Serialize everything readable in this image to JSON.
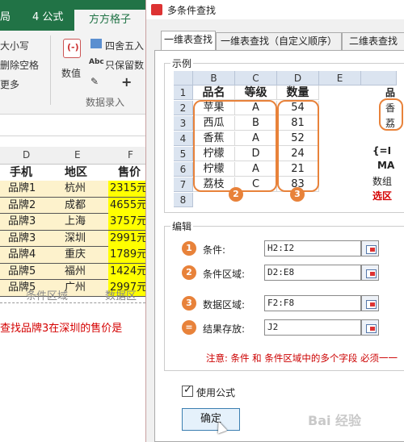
{
  "excel": {
    "tabs": [
      "局",
      "4 公式",
      "方方格子"
    ],
    "ribbon": {
      "left_items": [
        "大小写",
        "删除空格",
        "更多"
      ],
      "group_buttons": [
        "四舍五入",
        "只保留数",
        "数值"
      ],
      "group_label": "数据录入",
      "numeric_button": "数值"
    },
    "columns": [
      "D",
      "E",
      "F"
    ],
    "headers": [
      "手机",
      "地区",
      "售价"
    ],
    "rows": [
      {
        "phone": "品牌1",
        "region": "杭州",
        "price": "2315元"
      },
      {
        "phone": "品牌2",
        "region": "成都",
        "price": "4655元"
      },
      {
        "phone": "品牌3",
        "region": "上海",
        "price": "3757元"
      },
      {
        "phone": "品牌3",
        "region": "深圳",
        "price": "2991元"
      },
      {
        "phone": "品牌4",
        "region": "重庆",
        "price": "1789元"
      },
      {
        "phone": "品牌5",
        "region": "福州",
        "price": "1424元"
      },
      {
        "phone": "品牌5",
        "region": "广州",
        "price": "2997元"
      }
    ],
    "footer_labels": [
      "条件区域",
      "数据区"
    ],
    "red_note": "查找品牌3在深圳的售价是"
  },
  "dialog": {
    "title": "多条件查找",
    "tabs": [
      "一维表查找",
      "一维表查找（自定义顺序）",
      "二维表查找"
    ],
    "example_group": "示例",
    "example": {
      "col_headers": [
        "B",
        "C",
        "D",
        "E"
      ],
      "row_numbers": [
        "1",
        "2",
        "3",
        "4",
        "5",
        "6",
        "7",
        "8"
      ],
      "header_row": [
        "品名",
        "等级",
        "数量"
      ],
      "rows": [
        [
          "苹果",
          "A",
          "54"
        ],
        [
          "西瓜",
          "B",
          "81"
        ],
        [
          "香蕉",
          "A",
          "52"
        ],
        [
          "柠檬",
          "D",
          "24"
        ],
        [
          "柠檬",
          "A",
          "21"
        ],
        [
          "荔枝",
          "C",
          "83"
        ]
      ],
      "badges": [
        "2",
        "3"
      ],
      "right_clip": [
        "品",
        "香",
        "荔",
        "{=I",
        "MA",
        "数组",
        "选区"
      ]
    },
    "edit_group": "编辑",
    "fields": [
      {
        "badge": "1",
        "label": "条件:",
        "value": "H2:I2"
      },
      {
        "badge": "2",
        "label": "条件区域:",
        "value": "D2:E8"
      },
      {
        "badge": "3",
        "label": "数据区域:",
        "value": "F2:F8"
      },
      {
        "badge": "=",
        "label": "结果存放:",
        "value": "J2"
      }
    ],
    "note": "注意: 条件 和 条件区域中的多个字段 必须一一",
    "use_formula_label": "使用公式",
    "use_formula_checked": true,
    "ok_label": "确定",
    "watermark": "Bai 经验"
  },
  "colors": {
    "excel_green": "#217346",
    "highlight_yellow": "#ffff00",
    "cell_beige": "#fdf2cc",
    "accent_orange": "#e8823a",
    "note_red": "#d40000"
  }
}
